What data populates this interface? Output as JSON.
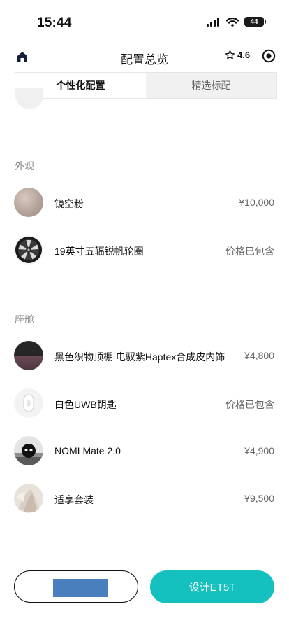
{
  "status_bar": {
    "time": "15:44",
    "battery": "44"
  },
  "nav": {
    "title": "配置总览",
    "rating": "4.6"
  },
  "tabs": [
    {
      "label": "个性化配置",
      "active": true
    },
    {
      "label": "精选标配",
      "active": false
    }
  ],
  "sections": [
    {
      "label": "外观",
      "items": [
        {
          "name": "镜空粉",
          "price": "¥10,000"
        },
        {
          "name": "19英寸五辐锐帆轮圈",
          "price": "价格已包含"
        }
      ]
    },
    {
      "label": "座舱",
      "items": [
        {
          "name": "黑色织物顶棚 电驭紫Haptex合成皮内饰",
          "price": "¥4,800"
        },
        {
          "name": "白色UWB钥匙",
          "price": "价格已包含"
        },
        {
          "name": "NOMI Mate 2.0",
          "price": "¥4,900"
        },
        {
          "name": "适享套装",
          "price": "¥9,500"
        }
      ]
    }
  ],
  "bottom": {
    "secondary_label": "",
    "primary_label": "设计ET5T"
  },
  "colors": {
    "accent": "#14c1be",
    "paint_swatch": "#b4a39a"
  }
}
